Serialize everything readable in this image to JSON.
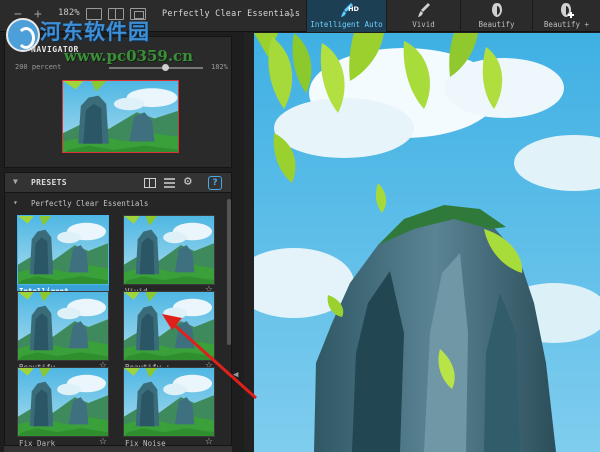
{
  "toolbar": {
    "zoom_minus": "−",
    "zoom_plus": "+",
    "zoom_level": "182%",
    "preset_name": "Perfectly Clear Essentials",
    "buttons": [
      {
        "label": "Intelligent Auto",
        "badge": "HD",
        "icon": "brush-icon",
        "active": true
      },
      {
        "label": "Vivid",
        "icon": "brush-icon",
        "active": false
      },
      {
        "label": "Beautify",
        "icon": "face-icon",
        "active": false
      },
      {
        "label": "Beautify +",
        "icon": "face-plus-icon",
        "active": false
      }
    ]
  },
  "watermark": {
    "title": "河东软件园",
    "url": "www.pc0359.cn"
  },
  "navigator": {
    "title": "NAVIGATOR",
    "min_label": "200 percent",
    "max_label": "182%",
    "zoom_fraction": 0.6
  },
  "presets": {
    "title": "PRESETS",
    "help_label": "?",
    "group_name": "Perfectly Clear Essentials",
    "items": [
      {
        "label": "Intelligent…",
        "selected": true
      },
      {
        "label": "Vivid",
        "star": "☆"
      },
      {
        "label": "Beautify",
        "star": "☆"
      },
      {
        "label": "Beautify +",
        "star": "☆"
      },
      {
        "label": "Fix Dark",
        "star": "☆"
      },
      {
        "label": "Fix Noise",
        "star": "☆"
      }
    ]
  },
  "colors": {
    "accent": "#3aa0d8",
    "active_button": "#1d3f53",
    "annotation_arrow": "#e0201a"
  }
}
